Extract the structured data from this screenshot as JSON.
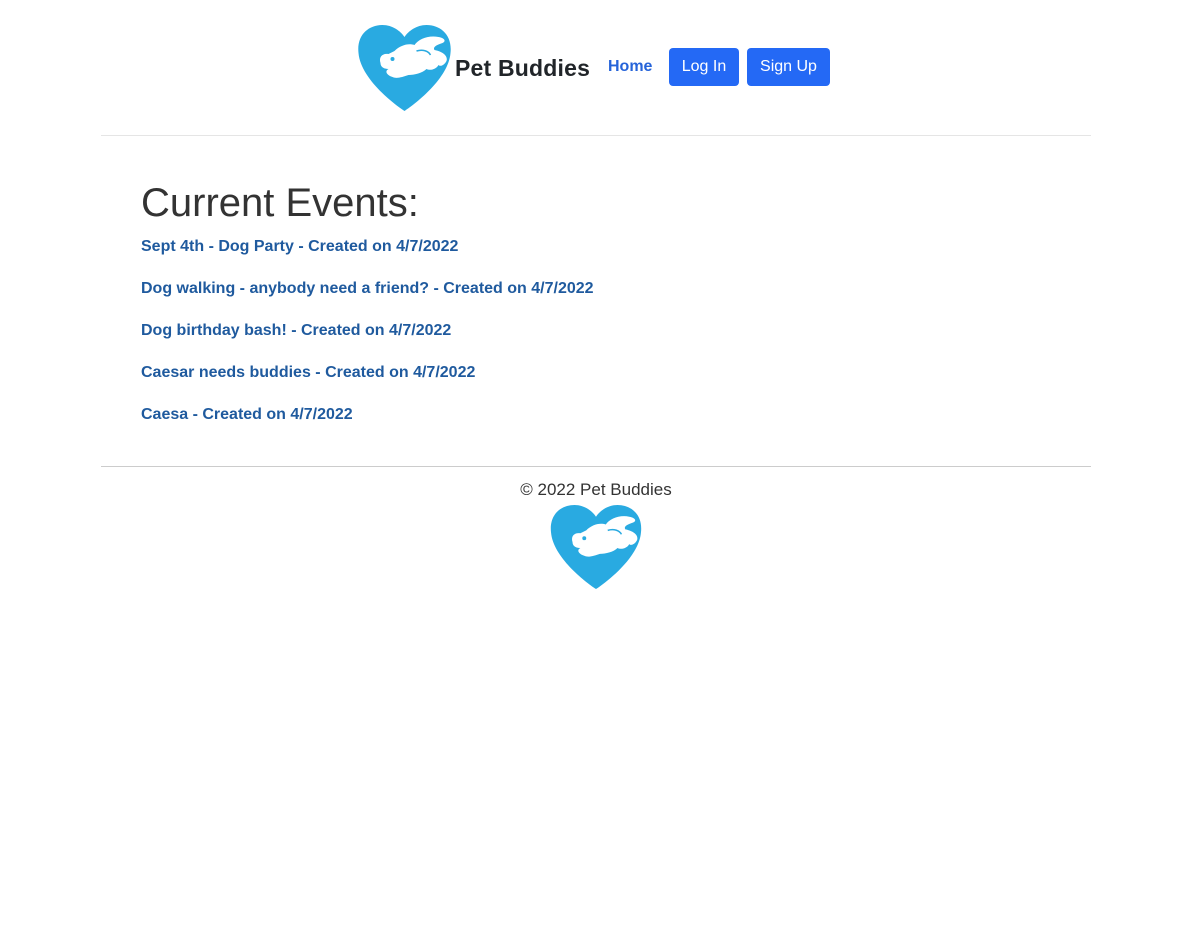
{
  "header": {
    "brand_name": "Pet Buddies",
    "logo_icon": "heart-dog-logo",
    "nav": {
      "home_label": "Home"
    },
    "buttons": {
      "login_label": "Log In",
      "signup_label": "Sign Up"
    }
  },
  "main": {
    "title": "Current Events:",
    "events": [
      {
        "label": "Sept 4th - Dog Party - Created on 4/7/2022"
      },
      {
        "label": "Dog walking - anybody need a friend? - Created on 4/7/2022"
      },
      {
        "label": "Dog birthday bash! - Created on 4/7/2022"
      },
      {
        "label": "Caesar needs buddies - Created on 4/7/2022"
      },
      {
        "label": "Caesa - Created on 4/7/2022"
      }
    ]
  },
  "footer": {
    "copyright": "© 2022 Pet Buddies",
    "logo_icon": "heart-dog-logo"
  },
  "colors": {
    "brand_blue": "#29aae1",
    "button_blue": "#2469f5",
    "link_blue": "#1f5a9e",
    "nav_blue": "#2563d9"
  }
}
